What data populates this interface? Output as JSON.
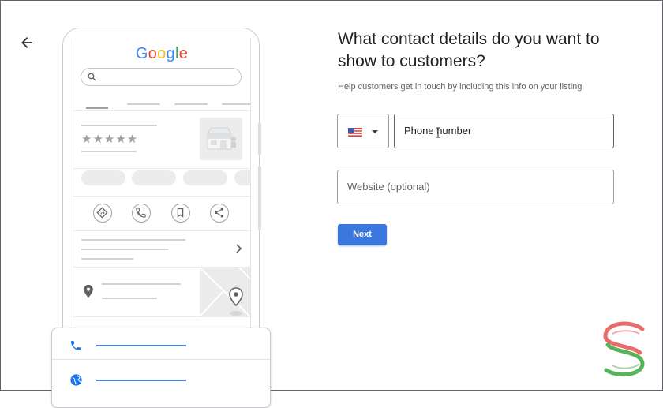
{
  "header": {
    "back_icon": "arrow-back-icon"
  },
  "preview": {
    "logo_letters": [
      "G",
      "o",
      "o",
      "g",
      "l",
      "e"
    ],
    "logo_colors": [
      "#4285f4",
      "#ea4335",
      "#fbbc05",
      "#4285f4",
      "#34a853",
      "#ea4335"
    ],
    "stars": "★★★★★",
    "action_icons": [
      "directions-icon",
      "call-icon",
      "bookmark-icon",
      "share-icon"
    ],
    "card_icons": [
      "phone-icon",
      "globe-icon"
    ]
  },
  "form": {
    "title": "What contact details do you want to show to customers?",
    "subtitle": "Help customers get in touch by including this info on your listing",
    "country": {
      "flag": "us-flag-icon"
    },
    "phone_placeholder": "Phone number",
    "website_placeholder": "Website (optional)",
    "next_label": "Next"
  },
  "colors": {
    "accent": "#3a78e0",
    "card_line": "#4a80e8"
  }
}
